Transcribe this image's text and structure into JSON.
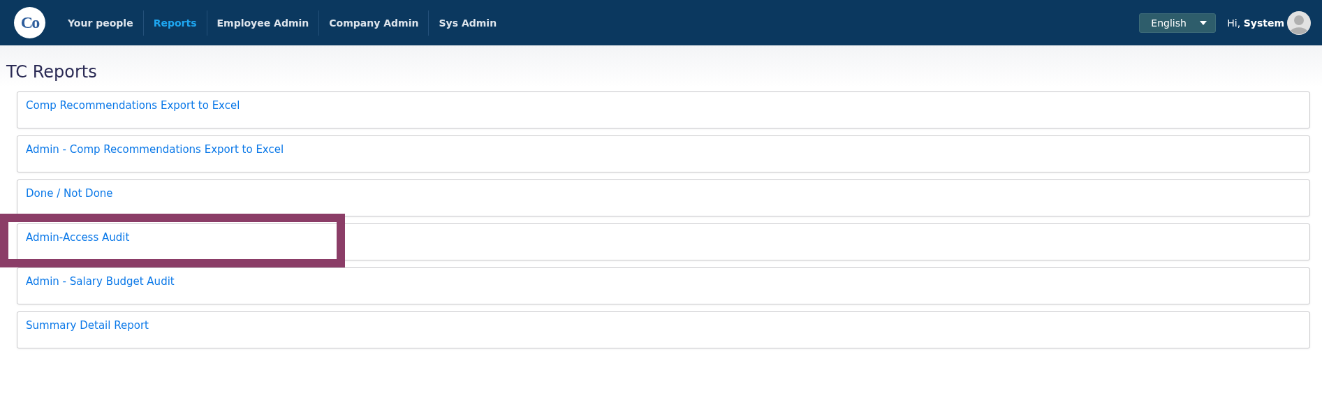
{
  "nav": {
    "logo_text": "Co",
    "items": [
      {
        "label": "Your people",
        "selected": false
      },
      {
        "label": "Reports",
        "selected": true
      },
      {
        "label": "Employee Admin",
        "selected": false
      },
      {
        "label": "Company Admin",
        "selected": false
      },
      {
        "label": "Sys Admin",
        "selected": false
      }
    ],
    "language": "English",
    "greeting": "Hi,",
    "user": "System"
  },
  "page_title": "TC Reports",
  "reports": [
    {
      "label": "Comp Recommendations Export to Excel",
      "highlighted": false
    },
    {
      "label": "Admin - Comp Recommendations Export to Excel",
      "highlighted": false
    },
    {
      "label": "Done / Not Done",
      "highlighted": false
    },
    {
      "label": "Admin-Access Audit",
      "highlighted": true
    },
    {
      "label": "Admin - Salary Budget Audit",
      "highlighted": false
    },
    {
      "label": "Summary Detail Report",
      "highlighted": false
    }
  ]
}
